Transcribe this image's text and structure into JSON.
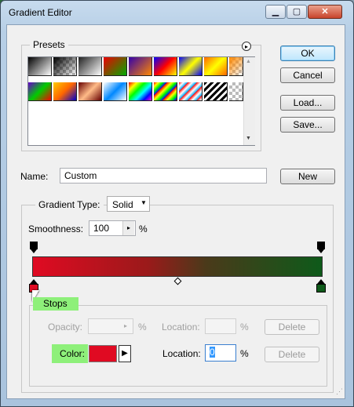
{
  "window": {
    "title": "Gradient Editor",
    "minimize": "▁",
    "maximize": "▢",
    "close": "✕"
  },
  "presets": {
    "label": "Presets",
    "menu_icon": "▸",
    "scroll_up": "▲",
    "scroll_down": "▼"
  },
  "buttons": {
    "ok": "OK",
    "cancel": "Cancel",
    "load": "Load...",
    "save": "Save...",
    "new": "New"
  },
  "name_field": {
    "label": "Name:",
    "value": "Custom"
  },
  "gradient": {
    "type_label": "Gradient Type:",
    "type_value": "Solid",
    "smoothness_label": "Smoothness:",
    "smoothness_value": "100",
    "smoothness_unit": "%",
    "start_color": "#e00a22",
    "end_color": "#0e5a1a"
  },
  "stops": {
    "label": "Stops",
    "opacity_label": "Opacity:",
    "opacity_value": "",
    "opacity_unit": "%",
    "location_label_top": "Location:",
    "location_value_top": "",
    "location_unit_top": "%",
    "delete_top": "Delete",
    "color_label": "Color:",
    "color_value": "#e00a22",
    "location_label": "Location:",
    "location_value": "0",
    "location_unit": "%",
    "delete_bottom": "Delete"
  }
}
